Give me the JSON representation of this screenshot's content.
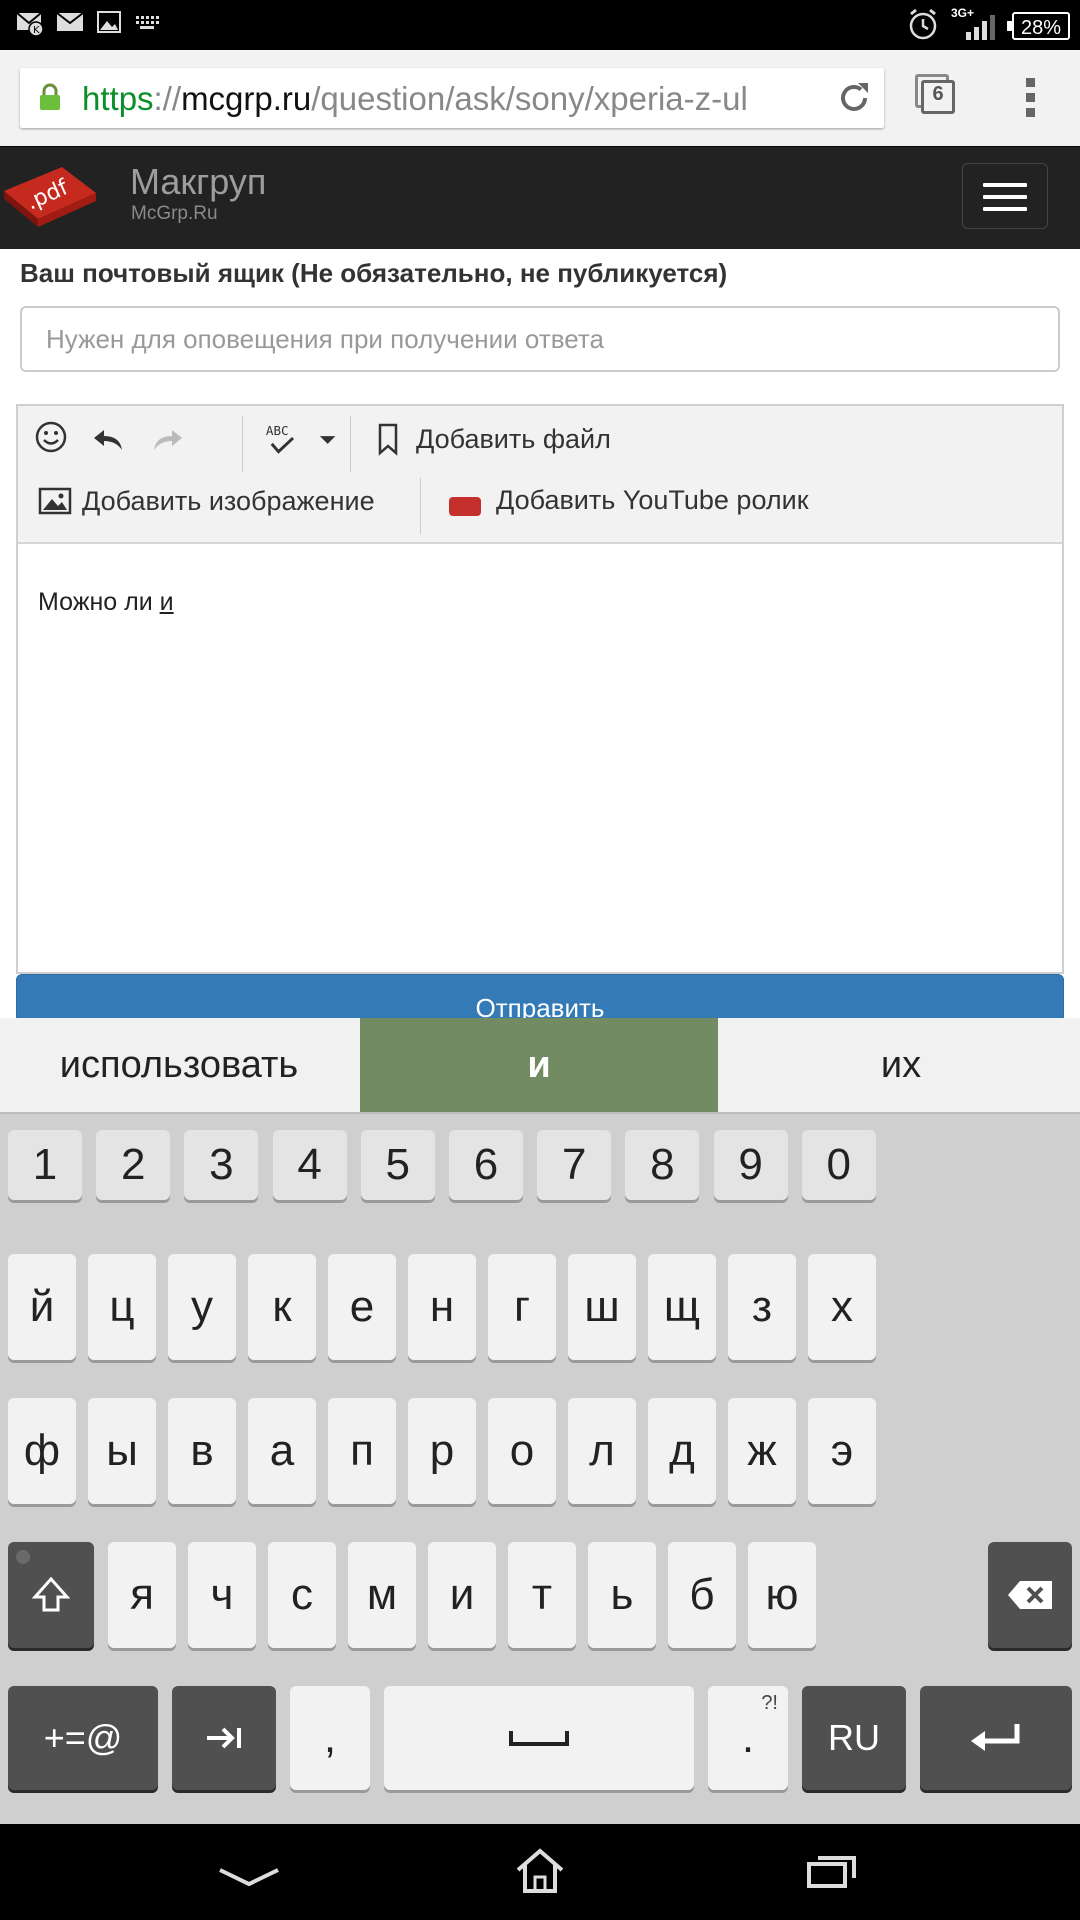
{
  "status_bar": {
    "icons": [
      "missed-mail-icon",
      "mail-icon",
      "image-icon",
      "keyboard-icon",
      "alarm-icon",
      "signal-icon"
    ],
    "network": "3G+",
    "battery": "28%"
  },
  "browser": {
    "url_scheme": "https",
    "url_sep": "://",
    "url_host": "mcgrp.ru",
    "url_path": "/question/ask/sony/xperia-z-ul",
    "tab_count": "6"
  },
  "site": {
    "logo_text": ".pdf",
    "name": "Макгруп",
    "subtitle": "McGrp.Ru"
  },
  "form": {
    "email_label": "Ваш почтовый ящик (Не обязательно, не публикуется)",
    "email_placeholder": "Нужен для оповещения при получении ответа",
    "email_value": "",
    "toolbar": {
      "spell_label": "ABC",
      "add_file": "Добавить файл",
      "add_image": "Добавить изображение",
      "add_youtube": "Добавить YouTube ролик",
      "youtube_badge_top": "You",
      "youtube_badge_bottom": "Tube"
    },
    "editor_text": "Можно ли ",
    "editor_composing": "и",
    "submit_label": "Отправить"
  },
  "keyboard": {
    "suggestions": [
      "использовать",
      "и",
      "их"
    ],
    "number_row": [
      "1",
      "2",
      "3",
      "4",
      "5",
      "6",
      "7",
      "8",
      "9",
      "0"
    ],
    "row1": [
      "й",
      "ц",
      "у",
      "к",
      "е",
      "н",
      "г",
      "ш",
      "щ",
      "з",
      "х"
    ],
    "row2": [
      "ф",
      "ы",
      "в",
      "а",
      "п",
      "р",
      "о",
      "л",
      "д",
      "ж",
      "э"
    ],
    "row3": [
      "я",
      "ч",
      "с",
      "м",
      "и",
      "т",
      "ь",
      "б",
      "ю"
    ],
    "symbols_key": "+=@",
    "comma_key": ",",
    "period_key": ".",
    "period_hint": "?!",
    "language_key": "RU"
  },
  "nav_bar": {
    "buttons": [
      "back-icon",
      "home-icon",
      "recent-apps-icon"
    ]
  },
  "colors": {
    "header_bg": "#222222",
    "submit_bg": "#337ab7",
    "suggestion_active": "#728b62",
    "url_scheme": "#0b8f28"
  }
}
